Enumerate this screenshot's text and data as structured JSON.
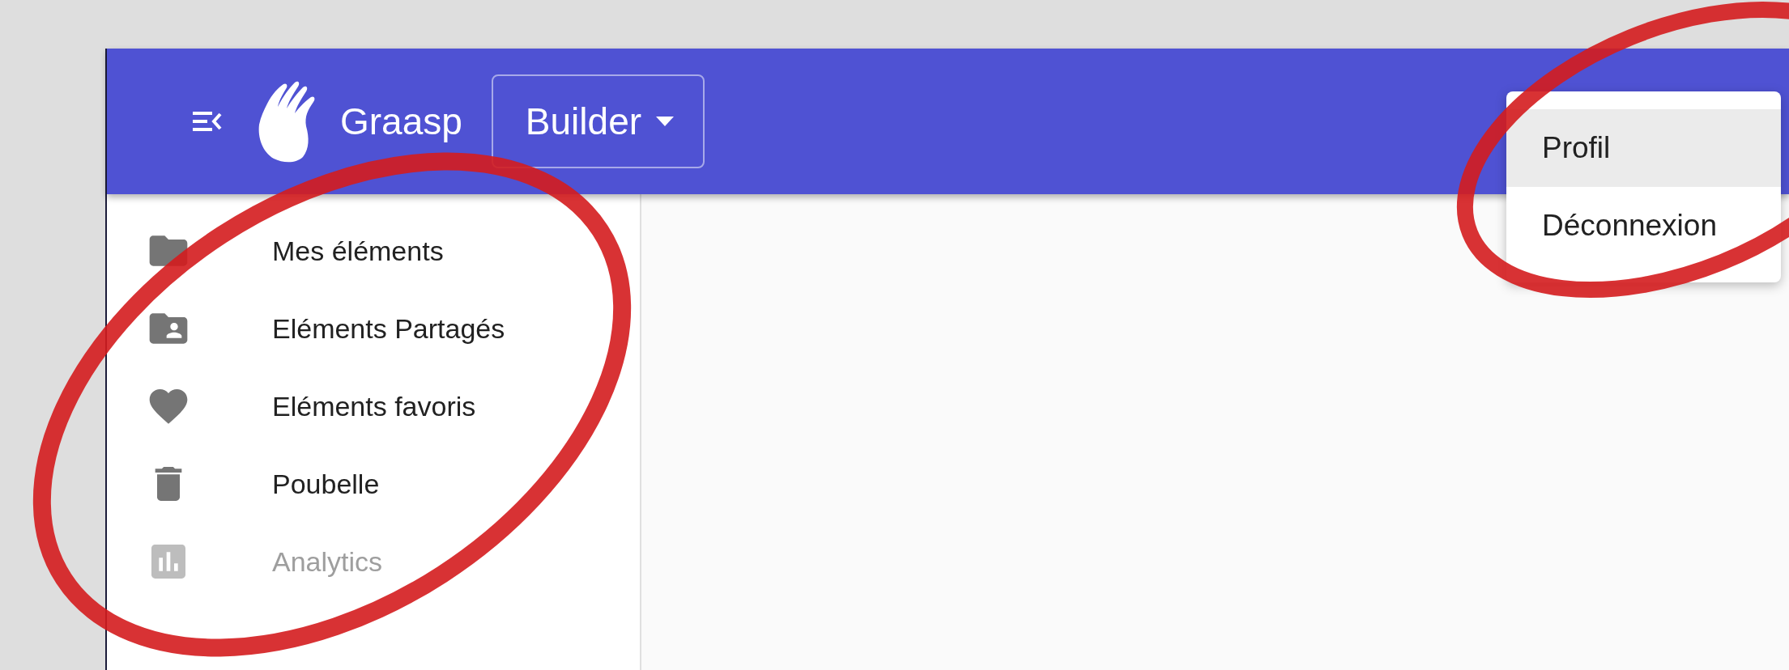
{
  "header": {
    "app_name": "Graasp",
    "context_button": "Builder"
  },
  "sidebar": {
    "items": [
      {
        "label": "Mes éléments",
        "kind": "folder",
        "disabled": false
      },
      {
        "label": "Eléments Partagés",
        "kind": "shared-folder",
        "disabled": false
      },
      {
        "label": "Eléments favoris",
        "kind": "heart",
        "disabled": false
      },
      {
        "label": "Poubelle",
        "kind": "trash",
        "disabled": false
      },
      {
        "label": "Analytics",
        "kind": "chart",
        "disabled": true
      }
    ]
  },
  "user_menu": {
    "items": [
      {
        "label": "Profil",
        "selected": true
      },
      {
        "label": "Déconnexion",
        "selected": false
      }
    ]
  }
}
